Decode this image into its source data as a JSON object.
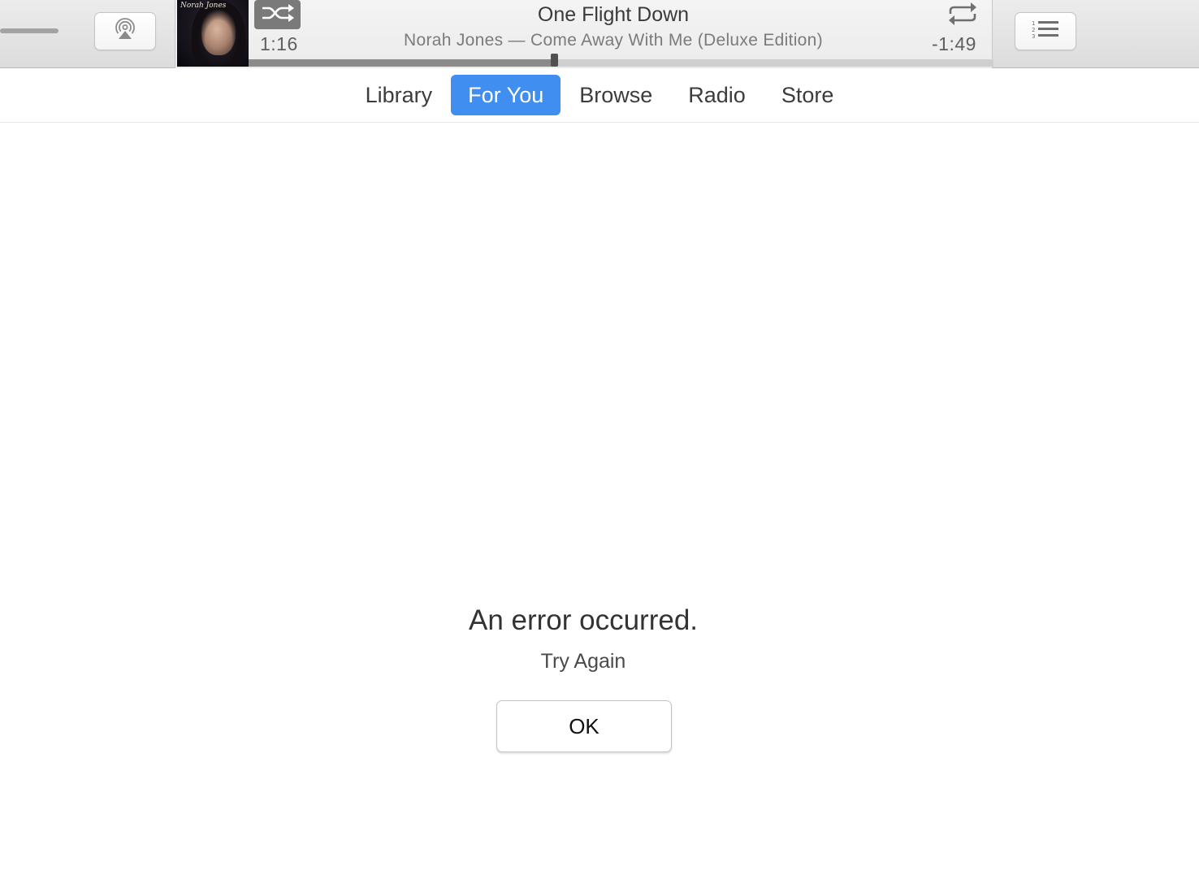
{
  "toolbar": {
    "volume_icon": "volume-slider",
    "airplay_icon": "airplay-icon",
    "upnext_icon": "numbered-list-icon"
  },
  "now_playing": {
    "title": "One Flight Down",
    "subtitle": "Norah Jones — Come Away With Me (Deluxe Edition)",
    "elapsed": "1:16",
    "remaining": "-1:49",
    "progress_fraction": 0.41,
    "artwork_signature": "Norah Jones",
    "shuffle_icon": "shuffle-icon",
    "repeat_icon": "repeat-icon"
  },
  "tabs": [
    {
      "label": "Library",
      "active": false
    },
    {
      "label": "For You",
      "active": true
    },
    {
      "label": "Browse",
      "active": false
    },
    {
      "label": "Radio",
      "active": false
    },
    {
      "label": "Store",
      "active": false
    }
  ],
  "error": {
    "title": "An error occurred.",
    "subtitle": "Try Again",
    "ok_label": "OK"
  },
  "colors": {
    "accent": "#3f8ef0",
    "toolbar_bg": "#e4e4e4",
    "progress_fill": "#8b8b8b"
  }
}
